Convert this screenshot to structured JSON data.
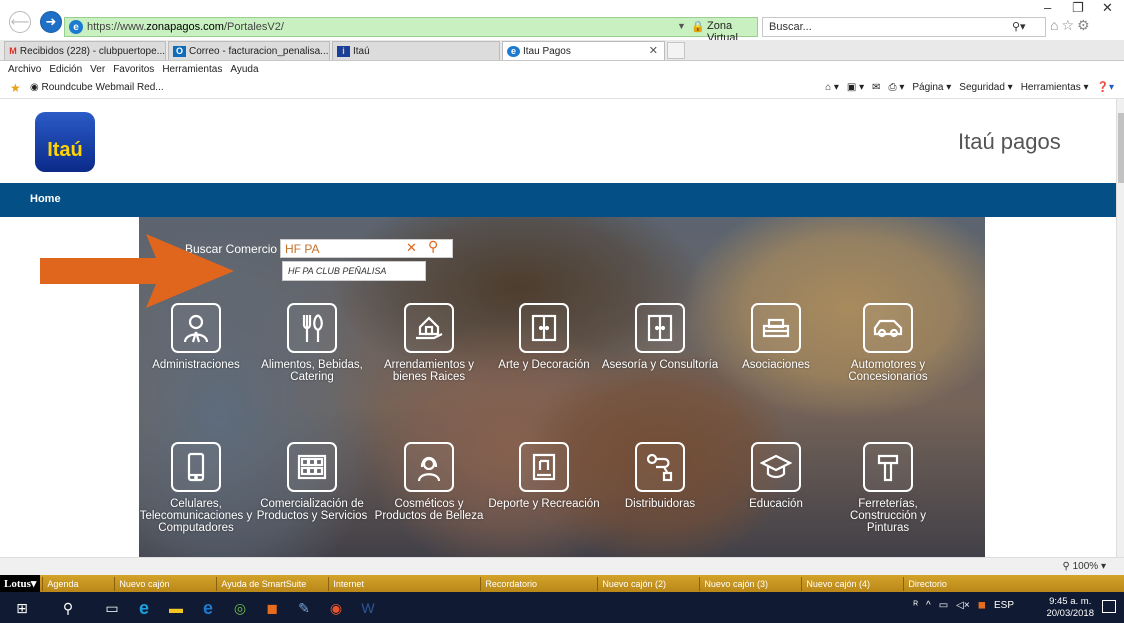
{
  "browser": {
    "url_prefix": "https://www.",
    "url_domain": "zonapagos.com",
    "url_path": "/PortalesV2/",
    "site_identity": "Zona Virtual S.A. [CO]",
    "search_placeholder": "Buscar...",
    "tabs": [
      {
        "label": "Recibidos (228) - clubpuertope...",
        "icon": "gmail-icon",
        "color": "#d93025"
      },
      {
        "label": "Correo - facturacion_penalisa...",
        "icon": "outlook-icon",
        "color": "#0f6cbd"
      },
      {
        "label": "Itaú",
        "icon": "itau-icon",
        "color": "#1a3e9e"
      },
      {
        "label": "Itau Pagos",
        "icon": "ie-icon",
        "color": "#1d7ad1"
      }
    ],
    "menu": [
      "Archivo",
      "Edición",
      "Ver",
      "Favoritos",
      "Herramientas",
      "Ayuda"
    ],
    "favorite_link": "Roundcube Webmail Red...",
    "command_bar": [
      "Página ▾",
      "Seguridad ▾",
      "Herramientas ▾"
    ],
    "zoom": "100%"
  },
  "page": {
    "logo_text": "Itaú",
    "site_title": "Itaú pagos",
    "nav_home": "Home",
    "search_label": "Buscar Comercio",
    "search_value": "HF PA",
    "suggestion": "HF PA CLUB PEÑALISA",
    "categories": [
      {
        "label": "Administraciones",
        "icon": "person-icon"
      },
      {
        "label": "Alimentos, Bebidas, Catering",
        "icon": "cutlery-icon"
      },
      {
        "label": "Arrendamientos y bienes Raices",
        "icon": "house-hand-icon"
      },
      {
        "label": "Arte y Decoración",
        "icon": "door-icon"
      },
      {
        "label": "Asesoría y Consultoría",
        "icon": "door-icon"
      },
      {
        "label": "Asociaciones",
        "icon": "sofa-icon"
      },
      {
        "label": "Automotores y Concesionarios",
        "icon": "car-icon"
      },
      {
        "label": "Celulares, Telecomunicaciones y Computadores",
        "icon": "phone-icon"
      },
      {
        "label": "Comercialización de Productos y Servicios",
        "icon": "grid-icon"
      },
      {
        "label": "Cosméticos y Productos de Belleza",
        "icon": "woman-icon"
      },
      {
        "label": "Deporte y Recreación",
        "icon": "shirt-icon"
      },
      {
        "label": "Distribuidoras",
        "icon": "route-icon"
      },
      {
        "label": "Educación",
        "icon": "graduation-cap-icon"
      },
      {
        "label": "Ferreterías, Construcción y Pinturas",
        "icon": "hammer-icon"
      }
    ]
  },
  "lotus_bar": [
    "Agenda",
    "Nuevo cajón",
    "Ayuda de SmartSuite",
    "Internet",
    "Recordatorio",
    "Nuevo cajón (2)",
    "Nuevo cajón (3)",
    "Nuevo cajón (4)",
    "Directorio"
  ],
  "taskbar": {
    "language": "ESP",
    "time": "9:45 a. m.",
    "date": "20/03/2018"
  },
  "colors": {
    "nav_blue": "#034f86",
    "accent_orange": "#e0651d",
    "address_green": "#c8f0c0"
  }
}
